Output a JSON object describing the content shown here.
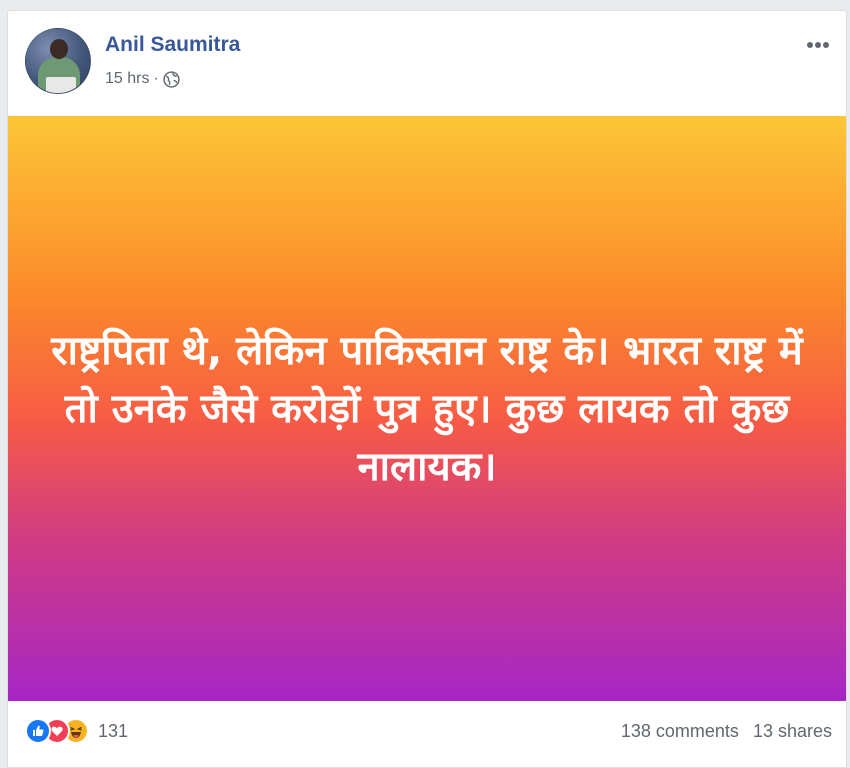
{
  "post": {
    "author_name": "Anil Saumitra",
    "timestamp": "15 hrs",
    "separator": "·",
    "privacy_icon": "globe-icon",
    "menu_icon": "more-options-icon",
    "banner_text": "राष्ट्रपिता थे, लेकिन पाकिस्तान राष्ट्र के। भारत राष्ट्र में तो उनके जैसे करोड़ों पुत्र हुए। कुछ लायक तो कुछ नालायक।",
    "banner_gradient": [
      "#fdc637",
      "#fb8b2a",
      "#f75b45",
      "#d13c82",
      "#a626c6"
    ]
  },
  "engagement": {
    "reaction_icons": [
      "like-icon",
      "love-icon",
      "haha-icon"
    ],
    "reaction_count": "131",
    "comments": "138 comments",
    "shares": "13 shares"
  },
  "colors": {
    "author_link": "#385898",
    "meta_text": "#616770",
    "like": "#1877f2",
    "love": "#f33e58",
    "haha": "#f7b125"
  }
}
